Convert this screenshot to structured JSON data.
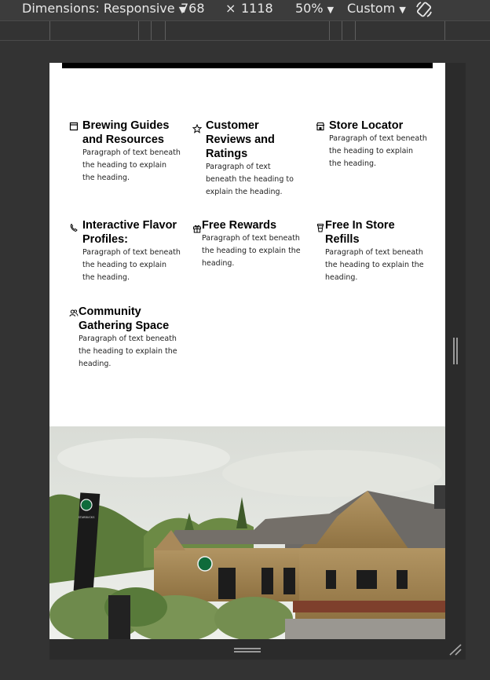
{
  "toolbar": {
    "dimensions_label": "Dimensions: Responsive",
    "width": "768",
    "times": "×",
    "height": "1118",
    "zoom": "50%",
    "throttle": "Custom"
  },
  "features": [
    {
      "icon": "book-icon",
      "title": "Brewing Guides and Resources",
      "text": "Paragraph of text beneath the heading to explain the heading."
    },
    {
      "icon": "star-icon",
      "title": "Customer Reviews and Ratings",
      "text": "Paragraph of text beneath the heading to explain the heading."
    },
    {
      "icon": "store-icon",
      "title": "Store Locator",
      "text": "Paragraph of text beneath the heading to explain the heading."
    },
    {
      "icon": "phone-icon",
      "title": "Interactive Flavor Profiles:",
      "text": "Paragraph of text beneath the heading to explain the heading."
    },
    {
      "icon": "gift-icon",
      "title": "Free Rewards",
      "text": "Paragraph of text beneath the heading to explain the heading."
    },
    {
      "icon": "cup-icon",
      "title": "Free In Store Refills",
      "text": "Paragraph of text beneath the heading to explain the heading."
    },
    {
      "icon": "community-icon",
      "title": "Community Gathering Space",
      "text": "Paragraph of text beneath the heading to explain the heading."
    }
  ],
  "photo": {
    "subject": "coffee-shop-building-photo",
    "sign_text": "STARBUCKS"
  }
}
